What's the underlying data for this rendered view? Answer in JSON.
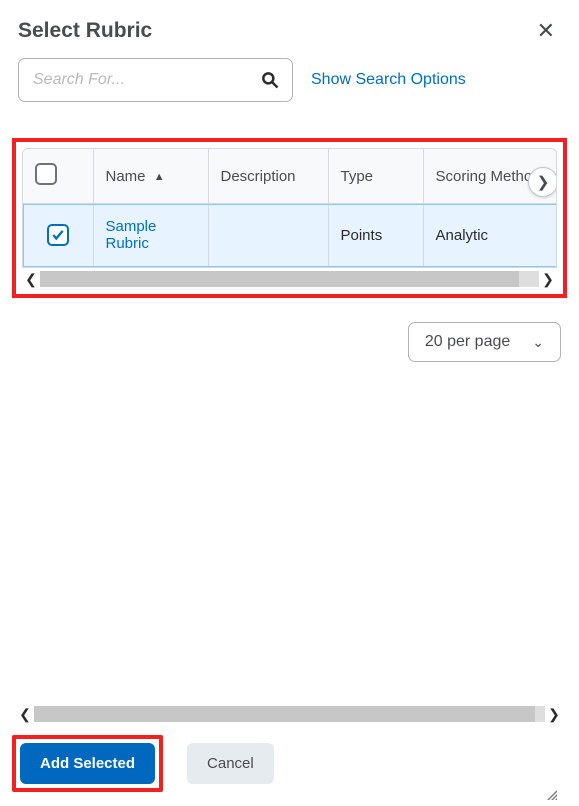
{
  "title": "Select Rubric",
  "search": {
    "placeholder": "Search For...",
    "show_options_label": "Show Search Options"
  },
  "table": {
    "columns": {
      "name": "Name",
      "description": "Description",
      "type": "Type",
      "scoring_method": "Scoring Method"
    },
    "sort": {
      "column": "name",
      "direction": "asc"
    },
    "rows": [
      {
        "checked": true,
        "name": "Sample Rubric",
        "description": "",
        "type": "Points",
        "scoring_method": "Analytic"
      }
    ]
  },
  "pagination": {
    "per_page_label": "20 per page"
  },
  "footer": {
    "add_selected_label": "Add Selected",
    "cancel_label": "Cancel"
  }
}
